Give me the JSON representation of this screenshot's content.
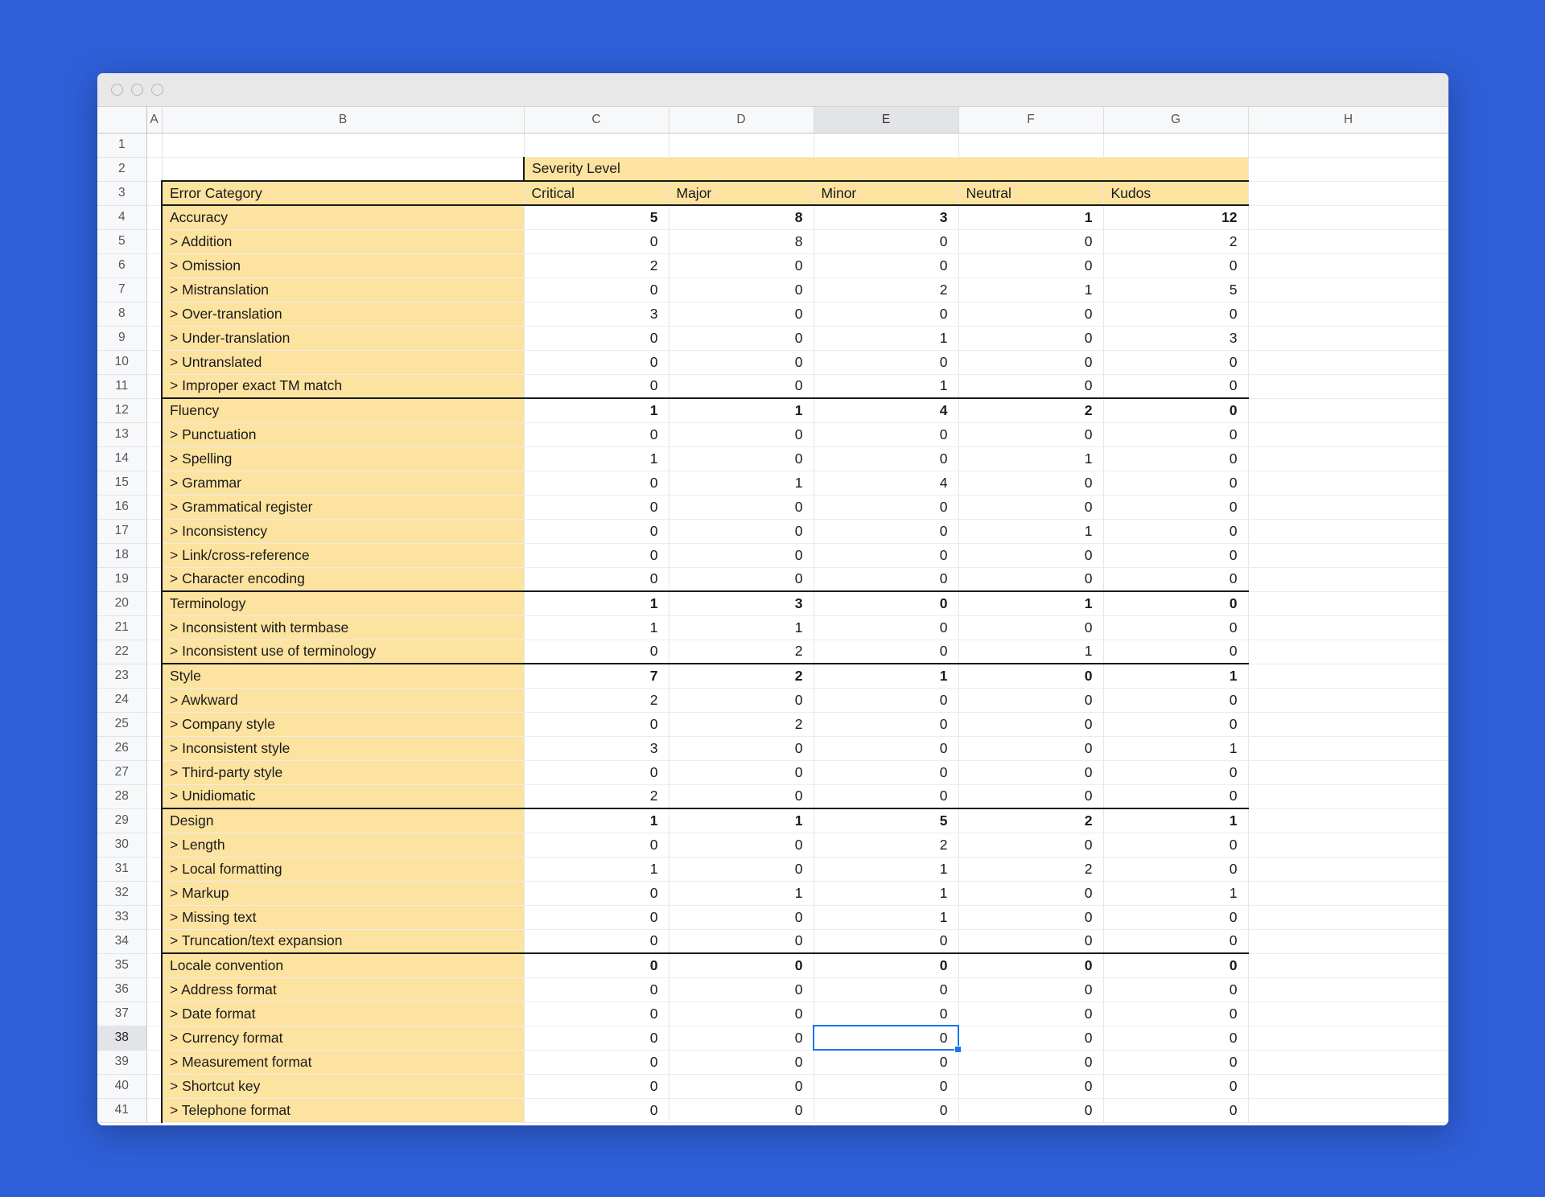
{
  "window": {
    "traffic_lights": [
      "close",
      "minimize",
      "maximize"
    ]
  },
  "grid": {
    "column_headers": [
      "A",
      "B",
      "C",
      "D",
      "E",
      "F",
      "G",
      "H"
    ],
    "active_column": "E",
    "active_row": 38,
    "row_numbers": [
      1,
      2,
      3,
      4,
      5,
      6,
      7,
      8,
      9,
      10,
      11,
      12,
      13,
      14,
      15,
      16,
      17,
      18,
      19,
      20,
      21,
      22,
      23,
      24,
      25,
      26,
      27,
      28,
      29,
      30,
      31,
      32,
      33,
      34,
      35,
      36,
      37,
      38,
      39,
      40,
      41
    ],
    "selected_cell": {
      "ref": "E38",
      "value": "0"
    }
  },
  "sheet": {
    "group_header": "Severity Level",
    "category_header": "Error Category",
    "severity_levels": [
      "Critical",
      "Major",
      "Minor",
      "Neutral",
      "Kudos"
    ],
    "rows": [
      {
        "row": 4,
        "label": "Accuracy",
        "type": "category",
        "values": [
          "5",
          "8",
          "3",
          "1",
          "12"
        ]
      },
      {
        "row": 5,
        "label": "> Addition",
        "type": "item",
        "values": [
          "0",
          "8",
          "0",
          "0",
          "2"
        ]
      },
      {
        "row": 6,
        "label": "> Omission",
        "type": "item",
        "values": [
          "2",
          "0",
          "0",
          "0",
          "0"
        ]
      },
      {
        "row": 7,
        "label": "> Mistranslation",
        "type": "item",
        "values": [
          "0",
          "0",
          "2",
          "1",
          "5"
        ]
      },
      {
        "row": 8,
        "label": "> Over-translation",
        "type": "item",
        "values": [
          "3",
          "0",
          "0",
          "0",
          "0"
        ]
      },
      {
        "row": 9,
        "label": "> Under-translation",
        "type": "item",
        "values": [
          "0",
          "0",
          "1",
          "0",
          "3"
        ]
      },
      {
        "row": 10,
        "label": "> Untranslated",
        "type": "item",
        "values": [
          "0",
          "0",
          "0",
          "0",
          "0"
        ]
      },
      {
        "row": 11,
        "label": "> Improper exact TM match",
        "type": "item",
        "values": [
          "0",
          "0",
          "1",
          "0",
          "0"
        ]
      },
      {
        "row": 12,
        "label": "Fluency",
        "type": "category",
        "values": [
          "1",
          "1",
          "4",
          "2",
          "0"
        ]
      },
      {
        "row": 13,
        "label": "> Punctuation",
        "type": "item",
        "values": [
          "0",
          "0",
          "0",
          "0",
          "0"
        ]
      },
      {
        "row": 14,
        "label": "> Spelling",
        "type": "item",
        "values": [
          "1",
          "0",
          "0",
          "1",
          "0"
        ]
      },
      {
        "row": 15,
        "label": "> Grammar",
        "type": "item",
        "values": [
          "0",
          "1",
          "4",
          "0",
          "0"
        ]
      },
      {
        "row": 16,
        "label": "> Grammatical register",
        "type": "item",
        "values": [
          "0",
          "0",
          "0",
          "0",
          "0"
        ]
      },
      {
        "row": 17,
        "label": "> Inconsistency",
        "type": "item",
        "values": [
          "0",
          "0",
          "0",
          "1",
          "0"
        ]
      },
      {
        "row": 18,
        "label": "> Link/cross-reference",
        "type": "item",
        "values": [
          "0",
          "0",
          "0",
          "0",
          "0"
        ]
      },
      {
        "row": 19,
        "label": "> Character encoding",
        "type": "item",
        "values": [
          "0",
          "0",
          "0",
          "0",
          "0"
        ]
      },
      {
        "row": 20,
        "label": "Terminology",
        "type": "category",
        "values": [
          "1",
          "3",
          "0",
          "1",
          "0"
        ]
      },
      {
        "row": 21,
        "label": "> Inconsistent with termbase",
        "type": "item",
        "values": [
          "1",
          "1",
          "0",
          "0",
          "0"
        ]
      },
      {
        "row": 22,
        "label": "> Inconsistent use of terminology",
        "type": "item",
        "values": [
          "0",
          "2",
          "0",
          "1",
          "0"
        ]
      },
      {
        "row": 23,
        "label": "Style",
        "type": "category",
        "values": [
          "7",
          "2",
          "1",
          "0",
          "1"
        ]
      },
      {
        "row": 24,
        "label": "> Awkward",
        "type": "item",
        "values": [
          "2",
          "0",
          "0",
          "0",
          "0"
        ]
      },
      {
        "row": 25,
        "label": "> Company style",
        "type": "item",
        "values": [
          "0",
          "2",
          "0",
          "0",
          "0"
        ]
      },
      {
        "row": 26,
        "label": "> Inconsistent style",
        "type": "item",
        "values": [
          "3",
          "0",
          "0",
          "0",
          "1"
        ]
      },
      {
        "row": 27,
        "label": "> Third-party style",
        "type": "item",
        "values": [
          "0",
          "0",
          "0",
          "0",
          "0"
        ]
      },
      {
        "row": 28,
        "label": "> Unidiomatic",
        "type": "item",
        "values": [
          "2",
          "0",
          "0",
          "0",
          "0"
        ]
      },
      {
        "row": 29,
        "label": "Design",
        "type": "category",
        "values": [
          "1",
          "1",
          "5",
          "2",
          "1"
        ]
      },
      {
        "row": 30,
        "label": "> Length",
        "type": "item",
        "values": [
          "0",
          "0",
          "2",
          "0",
          "0"
        ]
      },
      {
        "row": 31,
        "label": "> Local formatting",
        "type": "item",
        "values": [
          "1",
          "0",
          "1",
          "2",
          "0"
        ]
      },
      {
        "row": 32,
        "label": "> Markup",
        "type": "item",
        "values": [
          "0",
          "1",
          "1",
          "0",
          "1"
        ]
      },
      {
        "row": 33,
        "label": "> Missing text",
        "type": "item",
        "values": [
          "0",
          "0",
          "1",
          "0",
          "0"
        ]
      },
      {
        "row": 34,
        "label": "> Truncation/text expansion",
        "type": "item",
        "values": [
          "0",
          "0",
          "0",
          "0",
          "0"
        ]
      },
      {
        "row": 35,
        "label": "Locale convention",
        "type": "category",
        "values": [
          "0",
          "0",
          "0",
          "0",
          "0"
        ]
      },
      {
        "row": 36,
        "label": "> Address format",
        "type": "item",
        "values": [
          "0",
          "0",
          "0",
          "0",
          "0"
        ]
      },
      {
        "row": 37,
        "label": "> Date format",
        "type": "item",
        "values": [
          "0",
          "0",
          "0",
          "0",
          "0"
        ]
      },
      {
        "row": 38,
        "label": "> Currency format",
        "type": "item",
        "values": [
          "0",
          "0",
          "0",
          "0",
          "0"
        ]
      },
      {
        "row": 39,
        "label": "> Measurement format",
        "type": "item",
        "values": [
          "0",
          "0",
          "0",
          "0",
          "0"
        ]
      },
      {
        "row": 40,
        "label": "> Shortcut key",
        "type": "item",
        "values": [
          "0",
          "0",
          "0",
          "0",
          "0"
        ]
      },
      {
        "row": 41,
        "label": "> Telephone format",
        "type": "item",
        "values": [
          "0",
          "0",
          "0",
          "0",
          "0"
        ]
      }
    ]
  },
  "colors": {
    "desktop": "#2f5fd8",
    "highlight_fill": "#fde3a0",
    "selection": "#1a73e8",
    "header_bg": "#f7f8fa",
    "active_header_bg": "#e2e4e8"
  }
}
